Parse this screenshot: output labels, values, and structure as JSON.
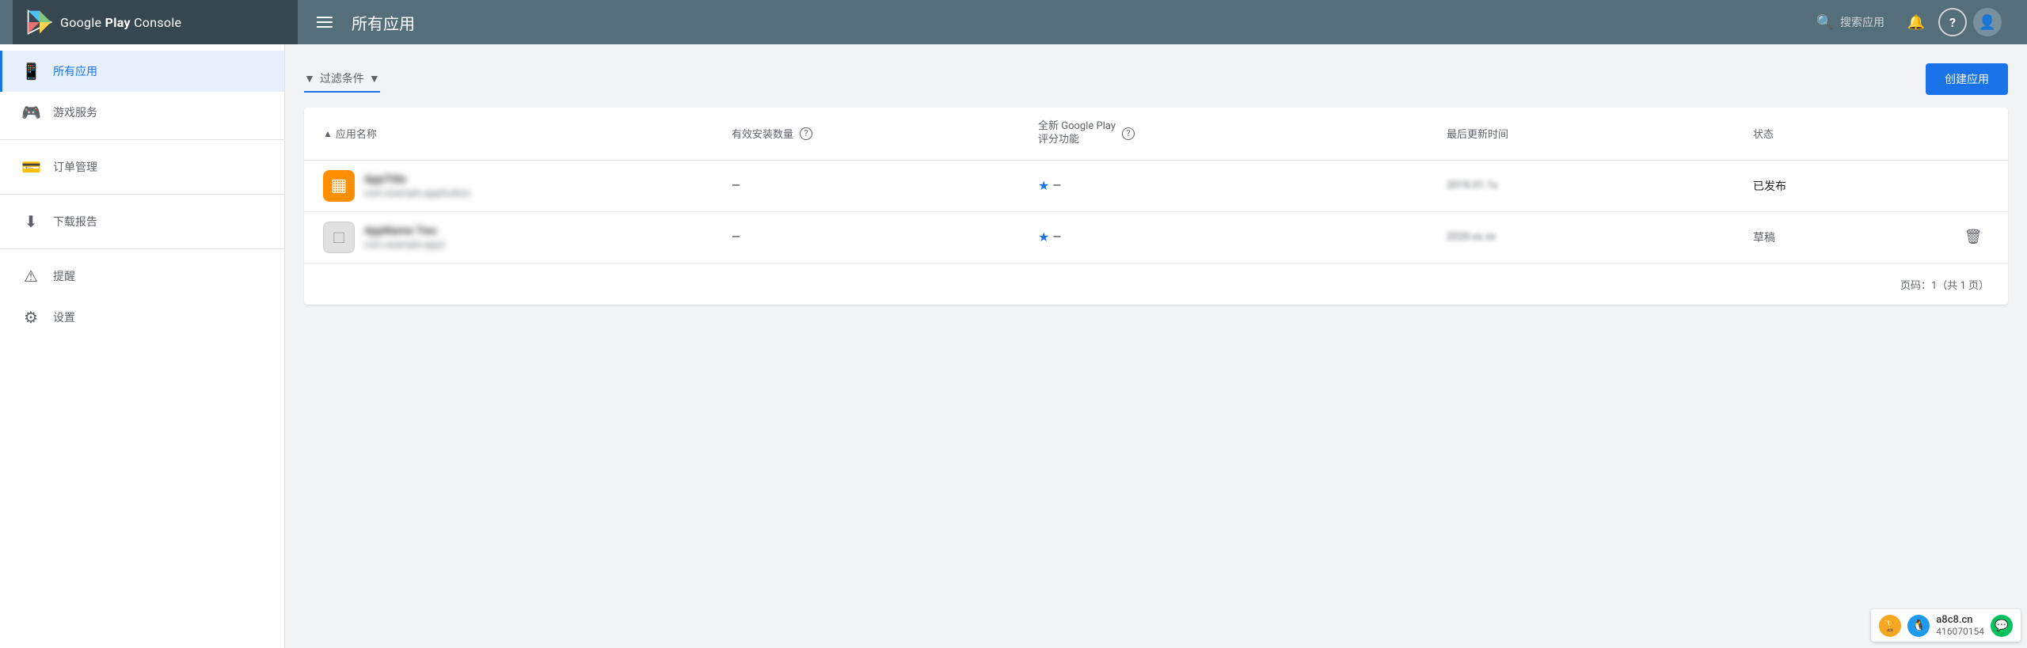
{
  "header": {
    "logo_text": "Google Play Console",
    "logo_text_bold": "Play",
    "page_title": "所有应用",
    "search_placeholder": "搜索应用",
    "hamburger_label": "Menu"
  },
  "sidebar": {
    "items": [
      {
        "id": "all-apps",
        "label": "所有应用",
        "icon": "📱",
        "active": true
      },
      {
        "id": "game-services",
        "label": "游戏服务",
        "icon": "🎮",
        "active": false
      },
      {
        "id": "order-management",
        "label": "订单管理",
        "icon": "💳",
        "active": false
      },
      {
        "id": "download-report",
        "label": "下载报告",
        "icon": "⬇",
        "active": false
      },
      {
        "id": "reminders",
        "label": "提醒",
        "icon": "⚠",
        "active": false
      },
      {
        "id": "settings",
        "label": "设置",
        "icon": "⚙",
        "active": false
      }
    ]
  },
  "filter": {
    "label": "过滤条件",
    "icon": "▼"
  },
  "create_btn": "创建应用",
  "table": {
    "headers": {
      "app_name": "应用名称",
      "installs": "有效安装数量",
      "rating": "全新 Google Play 评分功能",
      "updated": "最后更新时间",
      "status": "状态"
    },
    "sort_indicator": "▲",
    "rows": [
      {
        "id": "app-1",
        "name": "***",
        "package": "com.***.***.***",
        "icon_char": "▦",
        "icon_bg": "#ff8f00",
        "installs": "—",
        "rating": "★ —",
        "updated": "201*.**.1*",
        "status": "已发布",
        "status_class": "published"
      },
      {
        "id": "app-2",
        "name": "*** ***",
        "package": "com.***.***.***",
        "icon_char": "□",
        "icon_bg": "#e0e0e0",
        "installs": "—",
        "rating": "★ —",
        "updated": "20**.**.**.L",
        "status": "草稿",
        "status_class": "draft",
        "show_delete": true
      }
    ]
  },
  "pagination": {
    "text": "页码：1（共 1 页）"
  },
  "watermark": {
    "site": "a8c8.cn",
    "contact": "416070154"
  }
}
